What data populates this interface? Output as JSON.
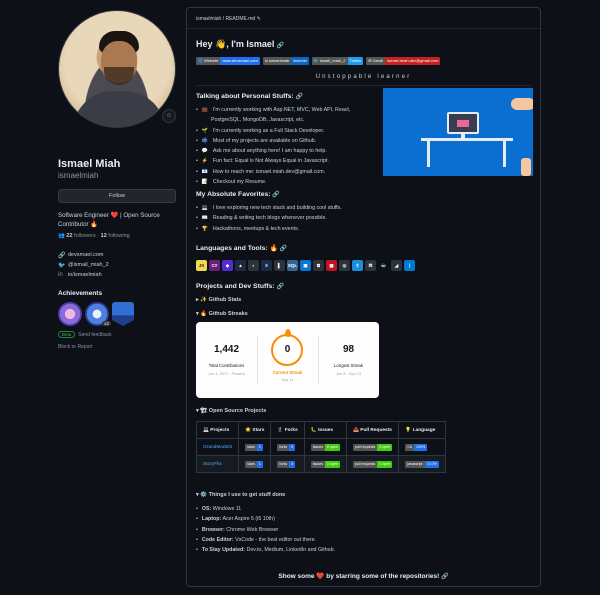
{
  "profile": {
    "name": "Ismael Miah",
    "username": "ismaelmiah",
    "follow_label": "Follow",
    "bio": "Software Engineer ❤️ | Open Source Contributor 🔥",
    "followers_count": "22",
    "followers_label": "followers",
    "following_count": "12",
    "following_label": "following",
    "website": "devsmael.com",
    "twitter": "@ismail_miah_2",
    "linkedin": "in/ismaelmiah",
    "achievements_title": "Achievements",
    "achievement_count": "x2",
    "beta_label": "Beta",
    "send_feedback": "Send feedback",
    "block_report": "Block or Report"
  },
  "readme": {
    "path": "ismaelmiah / README.md",
    "greeting": "Hey 👋, I'm Ismael",
    "contacts": [
      {
        "l": "🌐 Website",
        "r": "www.devsmael.com",
        "color": "#1f6feb"
      },
      {
        "l": "in ismaelmiah",
        "r": "linkedin",
        "color": "#0a66c2"
      },
      {
        "l": "🐦 ismail_miah_2",
        "r": "Twitter",
        "color": "#1d9bf0"
      },
      {
        "l": "✉ Gmail",
        "r": "ismael.miah.dev@gmail.com",
        "color": "#c5221f"
      }
    ],
    "tagline": "Unstoppable learner",
    "personal_title": "Talking about Personal Stuffs:",
    "personal": [
      {
        "emo": "💼",
        "text": "I'm currently working with Asp.NET, MVC, Web API, React,"
      },
      {
        "emo": "",
        "text": "PostgreSQL, MongoDB, Javascript, etc."
      },
      {
        "emo": "🌱",
        "text": "I'm currently working as a Full Stack Developer."
      },
      {
        "emo": "📫",
        "text": "Most of my projects are available on Github."
      },
      {
        "emo": "💬",
        "text": "Ask me about anything here! I am happy to help."
      },
      {
        "emo": "⚡",
        "text": "Fun fact: Equal is Not Always Equal in Javascript."
      },
      {
        "emo": "📧",
        "text": "How to reach me: ismael.miah.dev@gmail.com."
      },
      {
        "emo": "📝",
        "text": "Checkout my Resume."
      }
    ],
    "favorites_title": "My Absolute Favorites:",
    "favorites": [
      {
        "emo": "💻",
        "text": "I love exploring new tech stack and building cool stuffs."
      },
      {
        "emo": "📖",
        "text": "Reading & writing tech blogs whenever possible."
      },
      {
        "emo": "🏆",
        "text": "Hackathons, meetups & tech events."
      }
    ],
    "languages_title": "Languages and Tools: 🔥",
    "tools": [
      {
        "label": "JS",
        "color": "#f0db4f",
        "fg": "#222"
      },
      {
        "label": "C#",
        "color": "#68217a",
        "fg": "#fff"
      },
      {
        "label": "◆",
        "color": "#512bd4",
        "fg": "#fff"
      },
      {
        "label": "▲",
        "color": "#1e2a44",
        "fg": "#fff"
      },
      {
        "label": "◐",
        "color": "#2d333b",
        "fg": "#fff"
      },
      {
        "label": "⚛",
        "color": "#1e2a44",
        "fg": "#61dafb"
      },
      {
        "label": "▌",
        "color": "#2d333b",
        "fg": "#fff"
      },
      {
        "label": "SQL",
        "color": "#336791",
        "fg": "#fff"
      },
      {
        "label": "▣",
        "color": "#0078d4",
        "fg": "#fff"
      },
      {
        "label": "⧉",
        "color": "#2d333b",
        "fg": "#fff"
      },
      {
        "label": "▦",
        "color": "#c21325",
        "fg": "#fff"
      },
      {
        "label": "◎",
        "color": "#2d333b",
        "fg": "#fff"
      },
      {
        "label": "⇧",
        "color": "#1a8fd8",
        "fg": "#fff"
      },
      {
        "label": "⌘",
        "color": "#2d333b",
        "fg": "#fff"
      },
      {
        "label": "🐳",
        "color": "#0d1117",
        "fg": "#2496ed"
      },
      {
        "label": "◢",
        "color": "#2d333b",
        "fg": "#fff"
      },
      {
        "label": "⟩",
        "color": "#0078d4",
        "fg": "#fff"
      }
    ],
    "projects_title": "Projects and Dev Stuffs:",
    "github_stats": "✨ Github Stats",
    "github_streaks": "🔥 Github Streaks",
    "streak": {
      "total": "1,442",
      "total_label": "Total Contributions",
      "total_sub": "Jun 1, 2017 - Present",
      "current": "0",
      "current_label": "Current Streak",
      "current_sub": "Sep 14",
      "longest": "98",
      "longest_label": "Longest Streak",
      "longest_sub": "Jun 8 - Sep 13"
    },
    "open_source_title": "🏗 Open Source Projects",
    "table_headers": [
      "💻 Projects",
      "⭐ Stars",
      "🍴 Forks",
      "🐛 Issues",
      "📥 Pull Requests",
      "💡 Language"
    ],
    "table_rows": [
      {
        "name": "GrandModel3",
        "stars": {
          "l": "stars",
          "r": "1",
          "color": "#1f6feb"
        },
        "forks": {
          "l": "forks",
          "r": "0",
          "color": "#1f6feb"
        },
        "issues": {
          "l": "issues",
          "r": "0 open",
          "color": "#4c1"
        },
        "prs": {
          "l": "pull requests",
          "r": "0 open",
          "color": "#4c1"
        },
        "lang": {
          "l": "C#",
          "r": "100%",
          "color": "#1f6feb"
        }
      },
      {
        "name": "StoryFlix",
        "stars": {
          "l": "stars",
          "r": "1",
          "color": "#1f6feb"
        },
        "forks": {
          "l": "forks",
          "r": "0",
          "color": "#1f6feb"
        },
        "issues": {
          "l": "issues",
          "r": "0 open",
          "color": "#4c1"
        },
        "prs": {
          "l": "pull requests",
          "r": "0 open",
          "color": "#4c1"
        },
        "lang": {
          "l": "javascript",
          "r": "72.0%",
          "color": "#1f6feb"
        }
      }
    ],
    "things_title": "⚙️ Things I use to get stuff done",
    "things": [
      {
        "k": "OS:",
        "v": " Windows 11"
      },
      {
        "k": "Laptop:",
        "v": " Acer Aspire 5 (i5 10th)"
      },
      {
        "k": "Browser:",
        "v": " Chrome Web Browser"
      },
      {
        "k": "Code Editor:",
        "v": " VsCode - the best editor out there."
      },
      {
        "k": "To Stay Updated:",
        "v": " Dev.to, Medium, LinkedIn and Github."
      }
    ],
    "footer": "Show some ❤️ by starring some of the repositories!"
  }
}
